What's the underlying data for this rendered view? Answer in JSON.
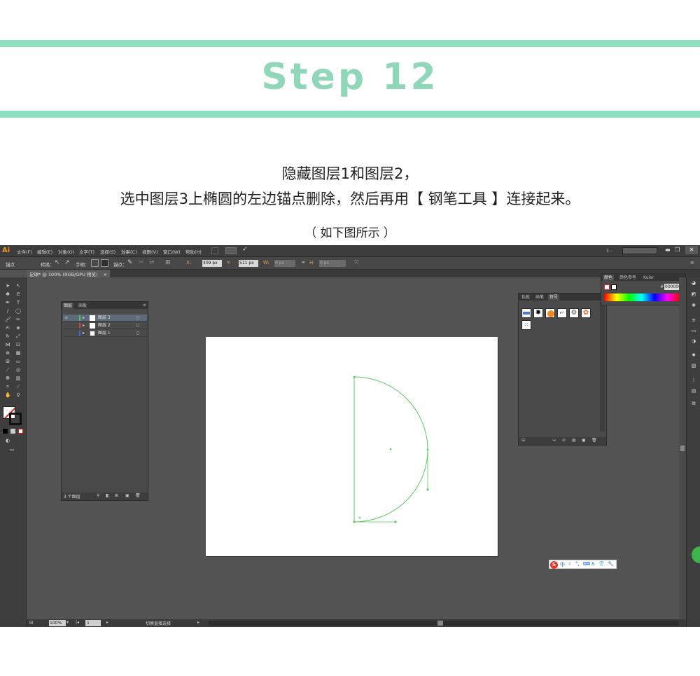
{
  "header": {
    "title": "Step 12",
    "accent_color": "#8fe0bf",
    "title_color": "#8fd7b8"
  },
  "instructions": {
    "line1": "隐藏图层1和图层2，",
    "line2": "选中图层3上椭圆的左边锚点删除，然后再用【 钢笔工具 】连接起来。",
    "line3": "（ 如下图所示 ）"
  },
  "app": {
    "logo": "Ai",
    "menus": [
      "文件(F)",
      "编辑(E)",
      "对象(O)",
      "文字(T)",
      "选择(S)",
      "效果(C)",
      "视图(V)",
      "窗口(W)",
      "帮助(H)"
    ],
    "workspace": "1 -",
    "control_bar": {
      "anchor_label": "锚点",
      "convert_label": "转换：",
      "handle_label": "手柄：",
      "anchor2_label": "锚点：",
      "x_value": "409 px",
      "y_value": "511 px",
      "w_value": "0 px",
      "h_value": "0 px"
    },
    "doc_tab": "足球* @ 100% (RGB/GPU 预览)",
    "layers_panel": {
      "tabs": [
        "图层",
        "画板"
      ],
      "layers": [
        {
          "name": "图层 3",
          "color": "#4fc84f",
          "selected": true
        },
        {
          "name": "图层 2",
          "color": "#e03a3a",
          "selected": false
        },
        {
          "name": "图层 1",
          "color": "#3a6ae0",
          "selected": false
        }
      ],
      "footer": "3 个图层"
    },
    "symbols_panel": {
      "tabs": [
        "色板",
        "画笔",
        "符号"
      ]
    },
    "color_panel": {
      "tabs": [
        "颜色",
        "颜色参考",
        "Kuler"
      ],
      "hex_value": "000000",
      "hash": "#"
    },
    "status_bar": {
      "zoom": "100%",
      "page": "1",
      "tool": "切换直接选择"
    },
    "ime_bar": {
      "label": "中"
    }
  }
}
